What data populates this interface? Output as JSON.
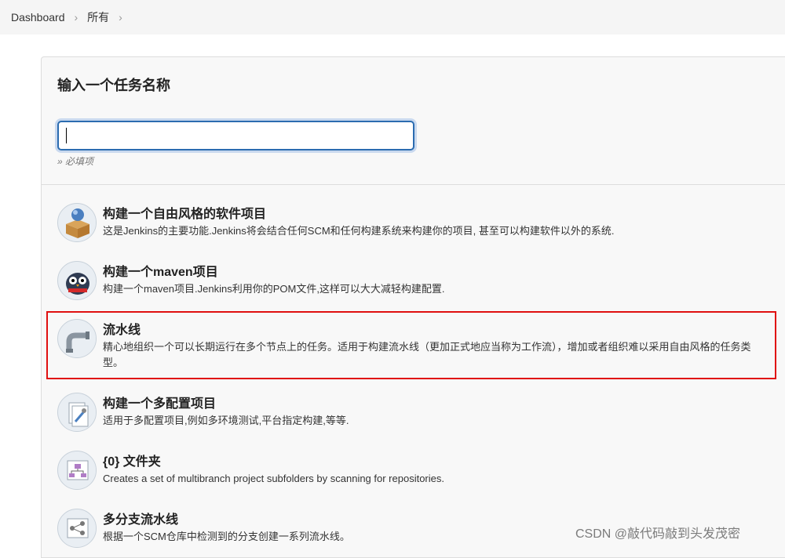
{
  "breadcrumb": {
    "items": [
      "Dashboard",
      "所有"
    ]
  },
  "form": {
    "title": "输入一个任务名称",
    "input_value": "",
    "required_note": "» 必填项"
  },
  "items": [
    {
      "name": "构建一个自由风格的软件项目",
      "desc": "这是Jenkins的主要功能.Jenkins将会结合任何SCM和任何构建系统来构建你的项目, 甚至可以构建软件以外的系统.",
      "icon": "freestyle-package-icon"
    },
    {
      "name": "构建一个maven项目",
      "desc": "构建一个maven项目.Jenkins利用你的POM文件,这样可以大大减轻构建配置.",
      "icon": "maven-owl-icon"
    },
    {
      "name": "流水线",
      "desc": "精心地组织一个可以长期运行在多个节点上的任务。适用于构建流水线（更加正式地应当称为工作流），增加或者组织难以采用自由风格的任务类型。",
      "icon": "pipeline-icon"
    },
    {
      "name": "构建一个多配置项目",
      "desc": "适用于多配置项目,例如多环境测试,平台指定构建,等等.",
      "icon": "multi-config-icon"
    },
    {
      "name": "{0} 文件夹",
      "desc": "Creates a set of multibranch project subfolders by scanning for repositories.",
      "icon": "organization-folder-icon"
    },
    {
      "name": "多分支流水线",
      "desc": "根据一个SCM仓库中检测到的分支创建一系列流水线。",
      "icon": "multibranch-icon"
    }
  ],
  "highlight_color": "#e01010",
  "watermark": "CSDN @敲代码敲到头发茂密"
}
